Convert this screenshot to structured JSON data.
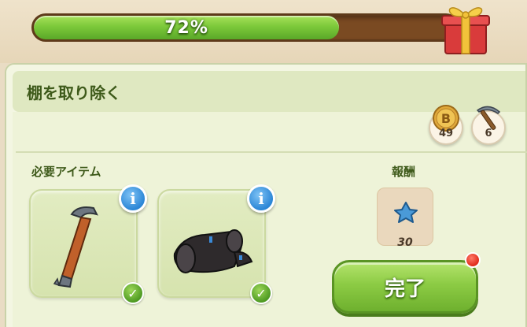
{
  "progress": {
    "percent": 72,
    "label": "72%"
  },
  "task": {
    "title": "棚を取り除く"
  },
  "costs": [
    {
      "icon": "coin-icon",
      "count": "49"
    },
    {
      "icon": "pickaxe-icon",
      "count": "6"
    }
  ],
  "required": {
    "label": "必要アイテム",
    "items": [
      {
        "icon": "crowbar-icon",
        "info": "i",
        "fulfilled": true
      },
      {
        "icon": "leather-rolls-icon",
        "info": "i",
        "fulfilled": true
      }
    ]
  },
  "reward": {
    "label": "報酬",
    "icon": "blue-star-icon",
    "count": "30"
  },
  "complete_button": {
    "label": "完了"
  },
  "colors": {
    "progress_fill": "#7cc93a",
    "progress_track": "#7a4a22",
    "button": "#8ccb44",
    "info": "#2b86d6",
    "notification": "#e02a1a"
  }
}
